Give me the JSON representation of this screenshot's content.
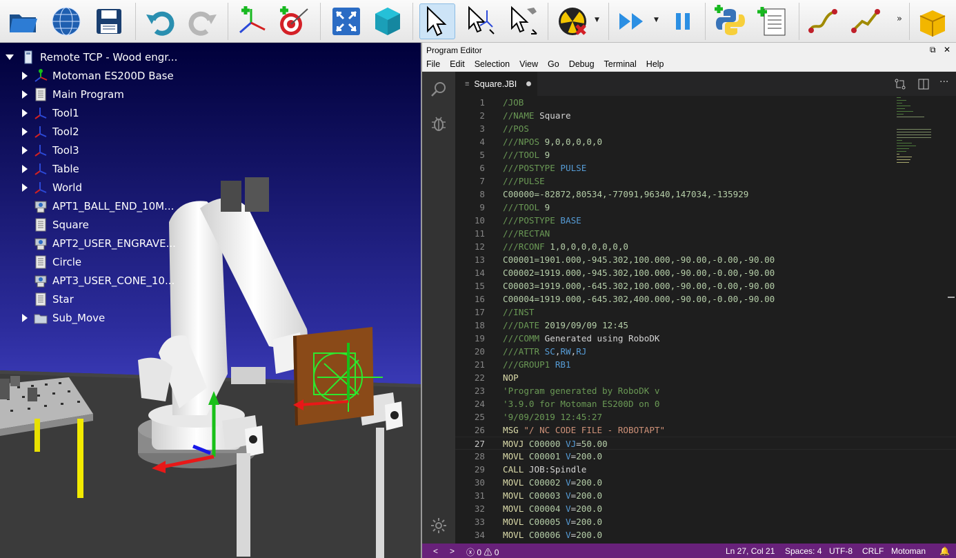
{
  "toolbar": {
    "buttons": [
      {
        "name": "open-icon",
        "color": "#1e6fb8"
      },
      {
        "name": "globe-icon",
        "color": "#2b6cc4"
      },
      {
        "name": "save-icon",
        "color": "#1a3f70"
      },
      {
        "name": "undo-icon",
        "color": "#2a8fb0"
      },
      {
        "name": "redo-icon",
        "color": "#b0b0b0"
      },
      {
        "name": "add-reference-frame-icon",
        "color": "#18b81e"
      },
      {
        "name": "add-target-icon",
        "color": "#c0202a"
      },
      {
        "name": "fit-all-icon",
        "color": "#2b6cc4"
      },
      {
        "name": "iso-view-icon",
        "color": "#1ba3b8"
      },
      {
        "name": "select-icon",
        "color": "#ffffff"
      },
      {
        "name": "move-reference-frame-icon",
        "color": "#ffffff"
      },
      {
        "name": "move-tool-icon",
        "color": "#ffffff"
      },
      {
        "name": "collision-check-icon",
        "color": "#f2c500"
      },
      {
        "name": "fast-simulation-icon",
        "color": "#2b8fe3"
      },
      {
        "name": "pause-icon",
        "color": "#2b8fe3"
      },
      {
        "name": "python-program-icon",
        "color": "#2ea84a"
      },
      {
        "name": "add-program-icon",
        "color": "#2ea84a"
      },
      {
        "name": "move-joint-icon",
        "color": "#a08a00"
      },
      {
        "name": "move-linear-icon",
        "color": "#a08a00"
      },
      {
        "name": "more-icon",
        "color": "#222222"
      },
      {
        "name": "package-icon",
        "color": "#f2a900"
      }
    ],
    "more": "»"
  },
  "tree": {
    "root": "Remote TCP - Wood engr...",
    "items": [
      {
        "label": "Motoman ES200D Base",
        "icon": "robot-base-icon",
        "expandable": true
      },
      {
        "label": "Main Program",
        "icon": "program-icon",
        "expandable": true
      },
      {
        "label": "Tool1",
        "icon": "frame-icon",
        "expandable": true
      },
      {
        "label": "Tool2",
        "icon": "frame-icon",
        "expandable": true
      },
      {
        "label": "Tool3",
        "icon": "frame-icon",
        "expandable": true
      },
      {
        "label": "Table",
        "icon": "frame-icon",
        "expandable": true
      },
      {
        "label": "World",
        "icon": "frame-icon",
        "expandable": true
      },
      {
        "label": "APT1_BALL_END_10M...",
        "icon": "machining-icon",
        "expandable": false
      },
      {
        "label": "Square",
        "icon": "program-icon",
        "expandable": false
      },
      {
        "label": "APT2_USER_ENGRAVE...",
        "icon": "machining-icon",
        "expandable": false
      },
      {
        "label": "Circle",
        "icon": "program-icon",
        "expandable": false
      },
      {
        "label": "APT3_USER_CONE_10...",
        "icon": "machining-icon",
        "expandable": false
      },
      {
        "label": "Star",
        "icon": "program-icon",
        "expandable": false
      },
      {
        "label": "Sub_Move",
        "icon": "folder-icon",
        "expandable": true
      }
    ]
  },
  "editor": {
    "window_title": "Program Editor",
    "menu": [
      "File",
      "Edit",
      "Selection",
      "View",
      "Go",
      "Debug",
      "Terminal",
      "Help"
    ],
    "tab": "Square.JBI",
    "current_line": 27,
    "lines": [
      [
        [
          "/JOB",
          "c-g"
        ]
      ],
      [
        [
          "//NAME ",
          "c-g"
        ],
        [
          "Square",
          "c-w"
        ]
      ],
      [
        [
          "//POS",
          "c-g"
        ]
      ],
      [
        [
          "///NPOS ",
          "c-g"
        ],
        [
          "9,0,0,0,0,0",
          "c-n"
        ]
      ],
      [
        [
          "///TOOL ",
          "c-g"
        ],
        [
          "9",
          "c-n"
        ]
      ],
      [
        [
          "///POSTYPE ",
          "c-g"
        ],
        [
          "PULSE",
          "c-b"
        ]
      ],
      [
        [
          "///PULSE",
          "c-g"
        ]
      ],
      [
        [
          "C00000=-82872,80534,-77091,96340,147034,-135929",
          "c-n"
        ]
      ],
      [
        [
          "///TOOL ",
          "c-g"
        ],
        [
          "9",
          "c-n"
        ]
      ],
      [
        [
          "///POSTYPE ",
          "c-g"
        ],
        [
          "BASE",
          "c-b"
        ]
      ],
      [
        [
          "///RECTAN",
          "c-g"
        ]
      ],
      [
        [
          "///RCONF ",
          "c-g"
        ],
        [
          "1,0,0,0,0,0,0,0",
          "c-n"
        ]
      ],
      [
        [
          "C00001=1901.000,-945.302,100.000,-90.00,-0.00,-90.00",
          "c-n"
        ]
      ],
      [
        [
          "C00002=1919.000,-945.302,100.000,-90.00,-0.00,-90.00",
          "c-n"
        ]
      ],
      [
        [
          "C00003=1919.000,-645.302,100.000,-90.00,-0.00,-90.00",
          "c-n"
        ]
      ],
      [
        [
          "C00004=1919.000,-645.302,400.000,-90.00,-0.00,-90.00",
          "c-n"
        ]
      ],
      [
        [
          "//INST",
          "c-g"
        ]
      ],
      [
        [
          "///DATE ",
          "c-g"
        ],
        [
          "2019/09/09 12:45",
          "c-n"
        ]
      ],
      [
        [
          "///COMM ",
          "c-g"
        ],
        [
          "Generated using RoboDK",
          "c-w"
        ]
      ],
      [
        [
          "///ATTR ",
          "c-g"
        ],
        [
          "SC",
          "c-b"
        ],
        [
          ",",
          "c-w"
        ],
        [
          "RW",
          "c-b"
        ],
        [
          ",",
          "c-w"
        ],
        [
          "RJ",
          "c-b"
        ]
      ],
      [
        [
          "///GROUP1 ",
          "c-g"
        ],
        [
          "RB1",
          "c-b"
        ]
      ],
      [
        [
          "NOP",
          "c-y"
        ]
      ],
      [
        [
          "'Program generated by RoboDK v",
          "c-g"
        ]
      ],
      [
        [
          "'3.9.0 for Motoman ES200D on 0",
          "c-g"
        ]
      ],
      [
        [
          "'9/09/2019 12:45:27",
          "c-g"
        ]
      ],
      [
        [
          "MSG ",
          "c-y"
        ],
        [
          "\"/ NC CODE FILE - ROBOTAPT\"",
          "c-o"
        ]
      ],
      [
        [
          "MOVJ ",
          "c-y"
        ],
        [
          "C00000 ",
          "c-n"
        ],
        [
          "VJ",
          "c-b"
        ],
        [
          "=",
          "c-w"
        ],
        [
          "50.00",
          "c-n"
        ]
      ],
      [
        [
          "MOVL ",
          "c-y"
        ],
        [
          "C00001 ",
          "c-n"
        ],
        [
          "V",
          "c-b"
        ],
        [
          "=",
          "c-w"
        ],
        [
          "200.0",
          "c-n"
        ]
      ],
      [
        [
          "CALL ",
          "c-y"
        ],
        [
          "JOB:Spindle",
          "c-w"
        ]
      ],
      [
        [
          "MOVL ",
          "c-y"
        ],
        [
          "C00002 ",
          "c-n"
        ],
        [
          "V",
          "c-b"
        ],
        [
          "=",
          "c-w"
        ],
        [
          "200.0",
          "c-n"
        ]
      ],
      [
        [
          "MOVL ",
          "c-y"
        ],
        [
          "C00003 ",
          "c-n"
        ],
        [
          "V",
          "c-b"
        ],
        [
          "=",
          "c-w"
        ],
        [
          "200.0",
          "c-n"
        ]
      ],
      [
        [
          "MOVL ",
          "c-y"
        ],
        [
          "C00004 ",
          "c-n"
        ],
        [
          "V",
          "c-b"
        ],
        [
          "=",
          "c-w"
        ],
        [
          "200.0",
          "c-n"
        ]
      ],
      [
        [
          "MOVL ",
          "c-y"
        ],
        [
          "C00005 ",
          "c-n"
        ],
        [
          "V",
          "c-b"
        ],
        [
          "=",
          "c-w"
        ],
        [
          "200.0",
          "c-n"
        ]
      ],
      [
        [
          "MOVL ",
          "c-y"
        ],
        [
          "C00006 ",
          "c-n"
        ],
        [
          "V",
          "c-b"
        ],
        [
          "=",
          "c-w"
        ],
        [
          "200.0",
          "c-n"
        ]
      ]
    ],
    "status": {
      "nav_back": "<",
      "nav_fwd": ">",
      "errors": "0",
      "warnings": "0",
      "position": "Ln 27, Col 21",
      "spaces": "Spaces: 4",
      "encoding": "UTF-8",
      "eol": "CRLF",
      "language": "Motoman"
    }
  },
  "colors": {
    "accent": "#68217a",
    "scene_sky": "#3c3cb8",
    "tree_text": "#ffffff"
  }
}
